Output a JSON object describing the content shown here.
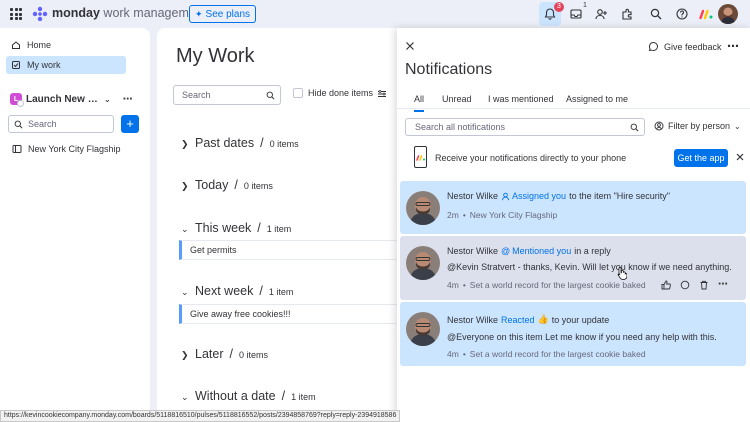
{
  "topbar": {
    "brand_bold": "monday",
    "brand_rest": " work management",
    "see_plans_label": "See plans",
    "notification_badge": "3",
    "inbox_badge": "1"
  },
  "sidebar": {
    "items": [
      {
        "label": "Home",
        "icon": "home-icon"
      },
      {
        "label": "My work",
        "icon": "my-work-icon"
      }
    ],
    "workspace_initial": "L",
    "workspace_name": "Launch New K...",
    "search_placeholder": "Search",
    "boards": [
      {
        "label": "New York City Flagship"
      }
    ]
  },
  "main": {
    "title": "My Work",
    "search_placeholder": "Search",
    "hide_done_label": "Hide done items",
    "groups": [
      {
        "label": "Past dates",
        "count": "0 items",
        "expanded": false
      },
      {
        "label": "Today",
        "count": "0 items",
        "expanded": false
      },
      {
        "label": "This week",
        "count": "1 item",
        "expanded": true,
        "task": "Get permits"
      },
      {
        "label": "Next week",
        "count": "1 item",
        "expanded": true,
        "task": "Give away free cookies!!!"
      },
      {
        "label": "Later",
        "count": "0 items",
        "expanded": false
      },
      {
        "label": "Without a date",
        "count": "1 item",
        "expanded": true
      }
    ]
  },
  "notifications": {
    "give_feedback_label": "Give feedback",
    "title": "Notifications",
    "tabs": [
      "All",
      "Unread",
      "I was mentioned",
      "Assigned to me"
    ],
    "active_tab": "All",
    "search_placeholder": "Search all notifications",
    "filter_label": "Filter by person",
    "promo_text": "Receive your notifications directly to your phone",
    "get_app_label": "Get the app",
    "items": [
      {
        "author": "Nestor Wilke",
        "action": "Assigned you",
        "rest": "to the item \"Hire security\"",
        "body": "",
        "time": "2m",
        "board": "New York City Flagship"
      },
      {
        "author": "Nestor Wilke",
        "action": "Mentioned you",
        "rest": "in a reply",
        "body": "@Kevin Stratvert - thanks, Kevin. Will let you know if we need anything.",
        "time": "4m",
        "board": "Set a world record for the largest cookie baked"
      },
      {
        "author": "Nestor Wilke",
        "action": "Reacted",
        "rest": "to your update",
        "body": "@Everyone on this item Let me know if you need any help with this.",
        "time": "4m",
        "board": "Set a world record for the largest cookie baked"
      }
    ]
  },
  "statusbar": {
    "url": "https://kevincookiecompany.monday.com/boards/5118816510/pulses/5118816552/posts/2394858769?reply=reply-2394918586"
  },
  "colors": {
    "accent": "#0073ea",
    "selected_bg": "#cce5ff",
    "badge_red": "#e2445c"
  }
}
